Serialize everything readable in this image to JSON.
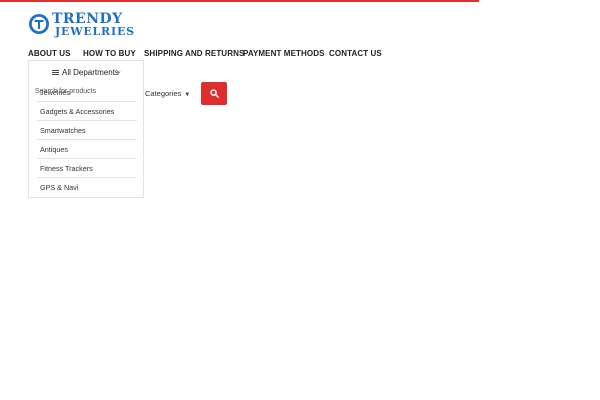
{
  "brand": {
    "name_line1": "TRENDY",
    "name_line2": "JEWELRIES",
    "accent": "#1f6fc6",
    "topbar_color": "#d9342b"
  },
  "nav": {
    "items": [
      {
        "label": "ABOUT US"
      },
      {
        "label": "HOW TO BUY"
      },
      {
        "label": "SHIPPING AND RETURNS"
      },
      {
        "label": "PAYMENT METHODS"
      },
      {
        "label": "CONTACT US"
      }
    ]
  },
  "departments": {
    "header": "All Departments",
    "header_icon": "hamburger-icon",
    "chevron_icon": "chevron-down-icon",
    "items": [
      {
        "label": "Jewelries"
      },
      {
        "label": "Gadgets & Accessories"
      },
      {
        "label": "Smartwatches"
      },
      {
        "label": "Antiques"
      },
      {
        "label": "Fitness Trackers"
      },
      {
        "label": "GPS & Navi"
      }
    ]
  },
  "search": {
    "placeholder": "Search for products",
    "category_label": "Categories",
    "button_icon": "search-icon",
    "button_color": "#dd2d2d"
  }
}
